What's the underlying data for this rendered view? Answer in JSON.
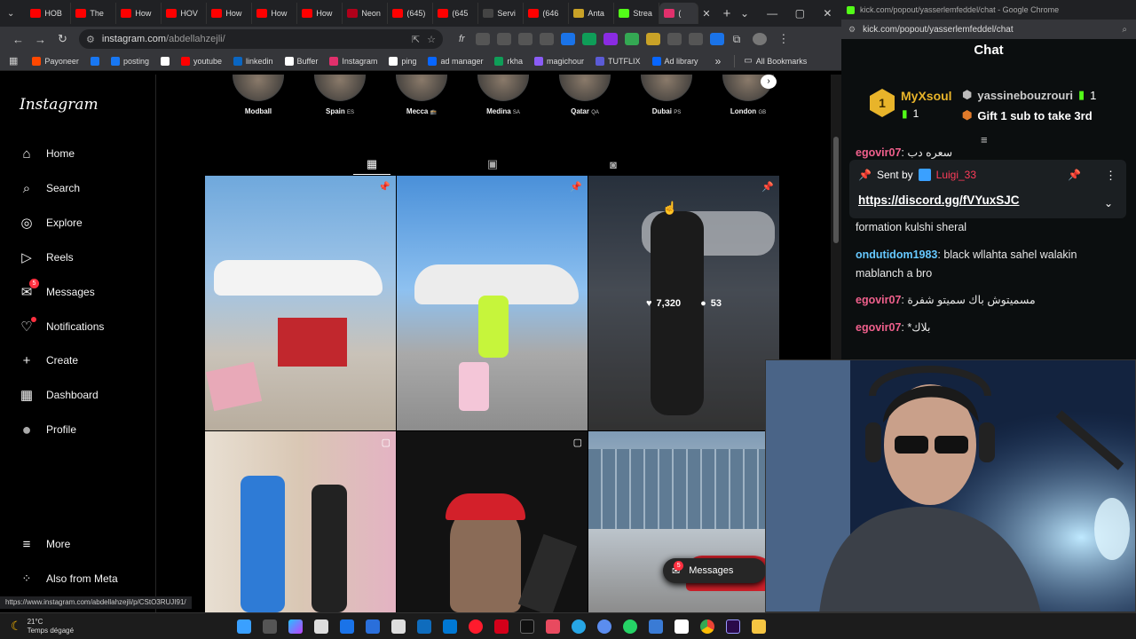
{
  "chrome": {
    "tabs": [
      {
        "label": "HOB",
        "color": "#ff0000"
      },
      {
        "label": "The",
        "color": "#ff0000"
      },
      {
        "label": "How",
        "color": "#ff0000"
      },
      {
        "label": "HOV",
        "color": "#ff0000"
      },
      {
        "label": "How",
        "color": "#ff0000"
      },
      {
        "label": "How",
        "color": "#ff0000"
      },
      {
        "label": "How",
        "color": "#ff0000"
      },
      {
        "label": "Neon",
        "color": "#b0001a"
      },
      {
        "label": "(645)",
        "color": "#ff0000"
      },
      {
        "label": "(645",
        "color": "#ff0000"
      },
      {
        "label": "Servi",
        "color": "#444444"
      },
      {
        "label": "(646",
        "color": "#ff0000"
      },
      {
        "label": "Anta",
        "color": "#c9a227"
      },
      {
        "label": "Strea",
        "color": "#53fc18"
      },
      {
        "label": "(",
        "color": "#e1306c"
      }
    ],
    "new_tab": "+",
    "url_host": "instagram.com",
    "url_path": "/abdellahzejli/",
    "bookmarks": [
      {
        "label": "Payoneer",
        "color": "#ff4800"
      },
      {
        "label": "",
        "color": "#1877f2"
      },
      {
        "label": "posting",
        "color": "#1877f2"
      },
      {
        "label": "",
        "color": "#ffffff"
      },
      {
        "label": "youtube",
        "color": "#ff0000"
      },
      {
        "label": "linkedin",
        "color": "#0a66c2"
      },
      {
        "label": "Buffer",
        "color": "#ffffff"
      },
      {
        "label": "Instagram",
        "color": "#e1306c"
      },
      {
        "label": "ping",
        "color": "#ffffff"
      },
      {
        "label": "ad manager",
        "color": "#0866ff"
      },
      {
        "label": "rkha",
        "color": "#0f9d58"
      },
      {
        "label": "magichour",
        "color": "#8a5cf6"
      },
      {
        "label": "TUTFLIX",
        "color": "#5b5bd6"
      },
      {
        "label": "Ad library",
        "color": "#0866ff"
      }
    ],
    "overflow": "»",
    "all_bookmarks": "All Bookmarks",
    "status_url": "https://www.instagram.com/abdellahzejli/p/CStO3RUJI91/"
  },
  "instagram": {
    "logo": "Instagram",
    "nav": [
      {
        "label": "Home",
        "icon": "home-icon",
        "glyph": "⌂"
      },
      {
        "label": "Search",
        "icon": "search-icon",
        "glyph": "⌕"
      },
      {
        "label": "Explore",
        "icon": "compass-icon",
        "glyph": "◎"
      },
      {
        "label": "Reels",
        "icon": "reels-icon",
        "glyph": "▷"
      },
      {
        "label": "Messages",
        "icon": "messenger-icon",
        "glyph": "✉",
        "badge": "5"
      },
      {
        "label": "Notifications",
        "icon": "heart-icon",
        "glyph": "♡"
      },
      {
        "label": "Create",
        "icon": "plus-icon",
        "glyph": "+"
      },
      {
        "label": "Dashboard",
        "icon": "dashboard-icon",
        "glyph": "▦"
      },
      {
        "label": "Profile",
        "icon": "avatar",
        "glyph": "●"
      }
    ],
    "more": "More",
    "also_from_meta": "Also from Meta",
    "highlights": [
      {
        "label": "Modball",
        "cc": ""
      },
      {
        "label": "Spain",
        "cc": "ES"
      },
      {
        "label": "Mecca",
        "cc": "🕋"
      },
      {
        "label": "Medina",
        "cc": "SA"
      },
      {
        "label": "Qatar",
        "cc": "QA"
      },
      {
        "label": "Dubai",
        "cc": "PS"
      },
      {
        "label": "London",
        "cc": "GB"
      }
    ],
    "hovered_post": {
      "likes": "7,320",
      "comments": "53"
    },
    "messages_pill": {
      "label": "Messages",
      "badge": "5"
    }
  },
  "kick": {
    "window_title": "kick.com/popout/yasserlemfeddel/chat - Google Chrome",
    "url": "kick.com/popout/yasserlemfeddel/chat",
    "chat_title": "Chat",
    "gifter_top": {
      "name": "MyXsoul",
      "count": "1"
    },
    "gifter_second": {
      "name": "yassinebouzrouri",
      "count": "1"
    },
    "gift_cta": "Gift 1 sub to take 3rd",
    "pinned": {
      "sent_by_label": "Sent by",
      "sender": "Luigi_33",
      "link": "https://discord.gg/fVYuxSJC"
    },
    "messages": [
      {
        "user": "egovir07",
        "color": "#f0608c",
        "text": "سعره دب"
      },
      {
        "user": "",
        "color": "#ffffff",
        "text": "formation kulshi sheral"
      },
      {
        "user": "ondutidom1983",
        "color": "#66c8ff",
        "text": "black wllahta sahel walakin mablanch a bro"
      },
      {
        "user": "egovir07",
        "color": "#f0608c",
        "text": "مسميتوش باك سميتو شفرة"
      },
      {
        "user": "egovir07",
        "color": "#f0608c",
        "text": "*بلاك"
      }
    ]
  },
  "taskbar": {
    "temperature": "21°C",
    "weather": "Temps dégagé"
  }
}
